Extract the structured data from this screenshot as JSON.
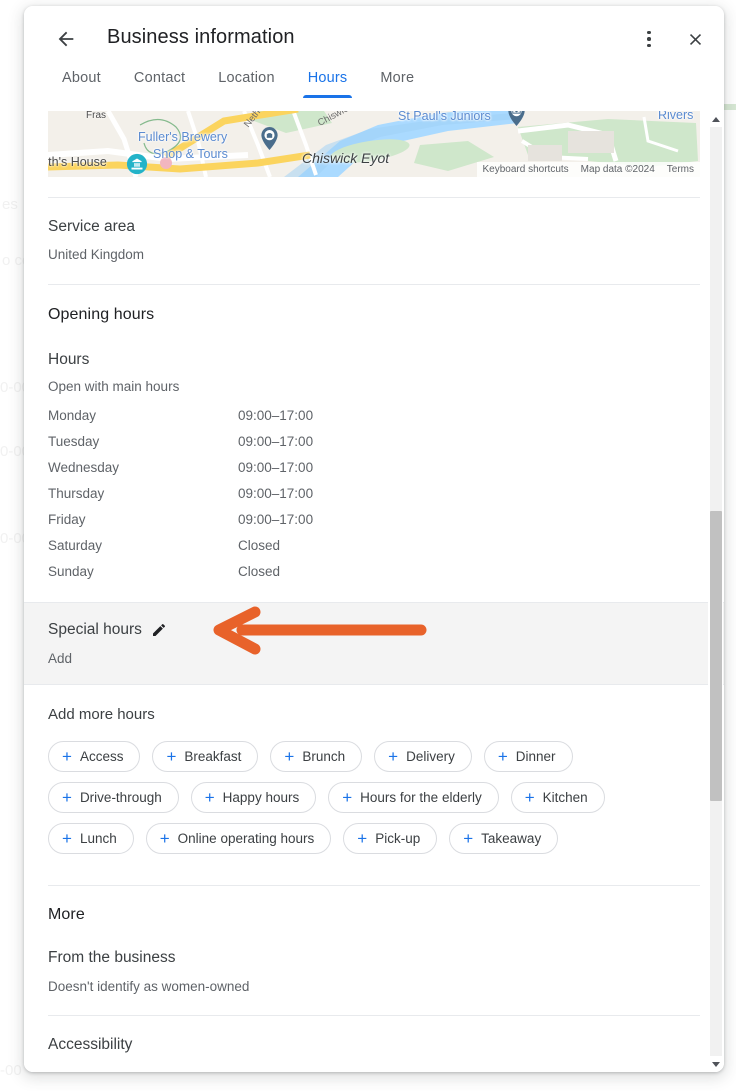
{
  "header": {
    "title": "Business information",
    "back_icon": "arrow-left-icon",
    "overflow_icon": "more-vert-icon",
    "close_icon": "close-icon"
  },
  "tabs": [
    {
      "label": "About",
      "active": false
    },
    {
      "label": "Contact",
      "active": false
    },
    {
      "label": "Location",
      "active": false
    },
    {
      "label": "Hours",
      "active": true
    },
    {
      "label": "More",
      "active": false
    }
  ],
  "map": {
    "labels": [
      "Fras",
      "Fuller's Brewery",
      "Shop & Tours",
      "rth's House",
      "Netheravon R",
      "Chiswick Mall",
      "Chiswick Eyot",
      "St Paul's Juniors",
      "Rivers"
    ],
    "attribution": [
      "Keyboard shortcuts",
      "Map data ©2024",
      "Terms"
    ]
  },
  "service_area": {
    "title": "Service area",
    "value": "United Kingdom"
  },
  "opening_hours": {
    "title": "Opening hours",
    "hours_label": "Hours",
    "status": "Open with main hours",
    "rows": [
      {
        "day": "Monday",
        "time": "09:00–17:00"
      },
      {
        "day": "Tuesday",
        "time": "09:00–17:00"
      },
      {
        "day": "Wednesday",
        "time": "09:00–17:00"
      },
      {
        "day": "Thursday",
        "time": "09:00–17:00"
      },
      {
        "day": "Friday",
        "time": "09:00–17:00"
      },
      {
        "day": "Saturday",
        "time": "Closed"
      },
      {
        "day": "Sunday",
        "time": "Closed"
      }
    ]
  },
  "special_hours": {
    "title": "Special hours",
    "edit_icon": "pencil-icon",
    "add_label": "Add"
  },
  "add_more_hours": {
    "title": "Add more hours",
    "chips": [
      "Access",
      "Breakfast",
      "Brunch",
      "Delivery",
      "Dinner",
      "Drive-through",
      "Happy hours",
      "Hours for the elderly",
      "Kitchen",
      "Lunch",
      "Online operating hours",
      "Pick-up",
      "Takeaway"
    ]
  },
  "more": {
    "title": "More",
    "from_business_title": "From the business",
    "from_business_value": "Doesn't identify as women-owned",
    "accessibility_title": "Accessibility"
  },
  "annotation": {
    "type": "arrow-left",
    "color": "#E8622A",
    "points_to": "Special hours"
  },
  "colors": {
    "accent_blue": "#1a73e8",
    "text_primary": "#202124",
    "text_secondary": "#5f6368",
    "divider": "#e8eaed",
    "highlight_band": "#f4f4f4",
    "annotation_orange": "#E8622A"
  },
  "background_ghost": [
    "es",
    "o co",
    "0-00",
    "0-00",
    "0-00",
    "-00"
  ]
}
